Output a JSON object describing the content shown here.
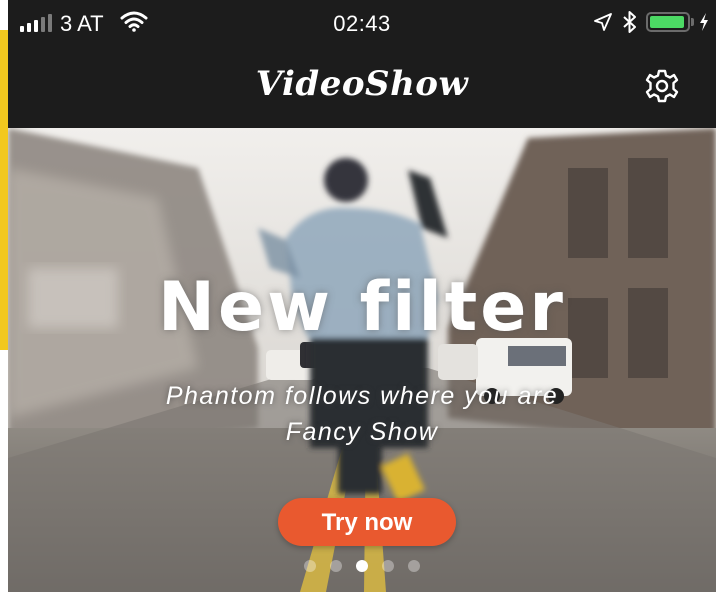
{
  "status_bar": {
    "carrier": "3 AT",
    "time": "02:43",
    "icons": [
      "signal-bars-icon",
      "wifi-icon",
      "location-arrow-icon",
      "bluetooth-icon",
      "battery-icon",
      "charging-bolt-icon"
    ],
    "signal_bars_filled": 3,
    "signal_bars_total": 5,
    "battery_level": 0.95,
    "battery_color": "#4cd964"
  },
  "header": {
    "logo_text": "VideoShow",
    "settings_icon": "gear-icon",
    "background": "#1c1c1c"
  },
  "banner": {
    "title": "New filter",
    "subtitle_line1": "Phantom follows where you are",
    "subtitle_line2": "Fancy Show",
    "button_label": "Try now",
    "button_color": "#e9592f",
    "page_count": 5,
    "active_page": 3
  }
}
